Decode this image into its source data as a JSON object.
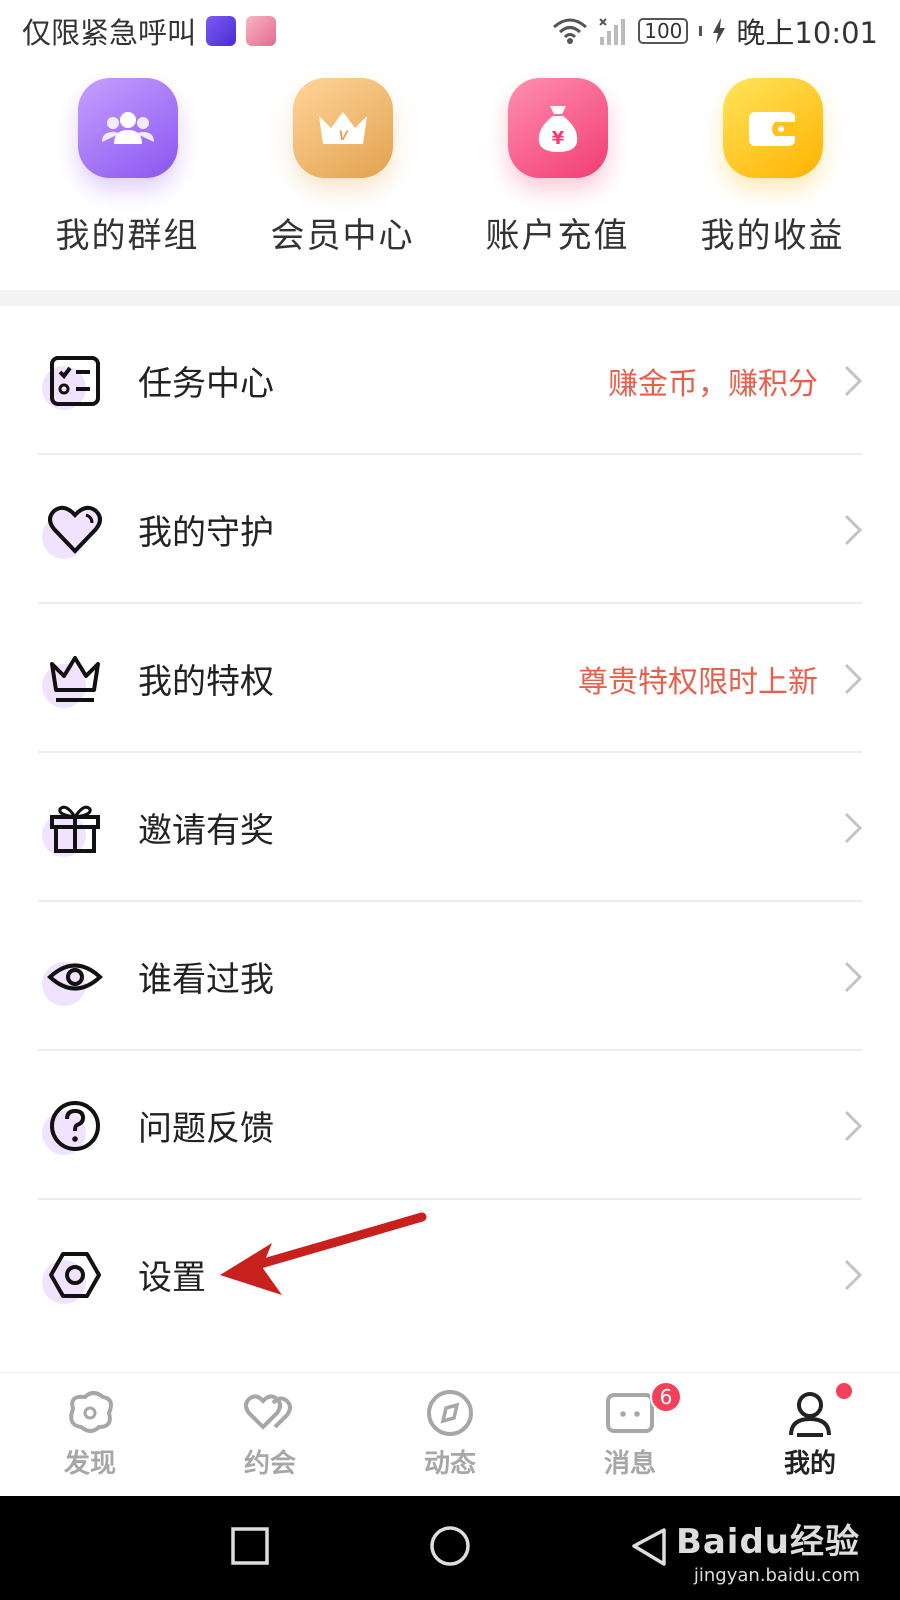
{
  "status_bar": {
    "left_text": "仅限紧急呼叫",
    "battery": "100",
    "time": "晚上10:01"
  },
  "quick_entries": [
    {
      "label": "我的群组",
      "icon": "group-icon",
      "color": "#9b6af5"
    },
    {
      "label": "会员中心",
      "icon": "crown-icon",
      "color": "#e8b065"
    },
    {
      "label": "账户充值",
      "icon": "money-bag-icon",
      "color": "#f54d82"
    },
    {
      "label": "我的收益",
      "icon": "wallet-icon",
      "color": "#ffc21a"
    }
  ],
  "menu": {
    "items": [
      {
        "label": "任务中心",
        "hint": "赚金币，赚积分",
        "icon": "task-list-icon"
      },
      {
        "label": "我的守护",
        "hint": "",
        "icon": "heart-icon"
      },
      {
        "label": "我的特权",
        "hint": "尊贵特权限时上新",
        "icon": "crown-outline-icon"
      },
      {
        "label": "邀请有奖",
        "hint": "",
        "icon": "gift-icon"
      },
      {
        "label": "谁看过我",
        "hint": "",
        "icon": "eye-icon"
      },
      {
        "label": "问题反馈",
        "hint": "",
        "icon": "question-icon"
      },
      {
        "label": "设置",
        "hint": "",
        "icon": "settings-hex-icon"
      }
    ]
  },
  "accent_hint_color": "#e8604c",
  "tab_bar": {
    "tabs": [
      {
        "label": "发现",
        "icon": "discover-icon"
      },
      {
        "label": "约会",
        "icon": "date-hearts-icon"
      },
      {
        "label": "动态",
        "icon": "compass-icon"
      },
      {
        "label": "消息",
        "icon": "message-icon",
        "badge": "6"
      },
      {
        "label": "我的",
        "icon": "profile-icon"
      }
    ],
    "active_tab": "我的"
  },
  "watermark": {
    "brand": "Baidu经验",
    "url": "jingyan.baidu.com"
  }
}
